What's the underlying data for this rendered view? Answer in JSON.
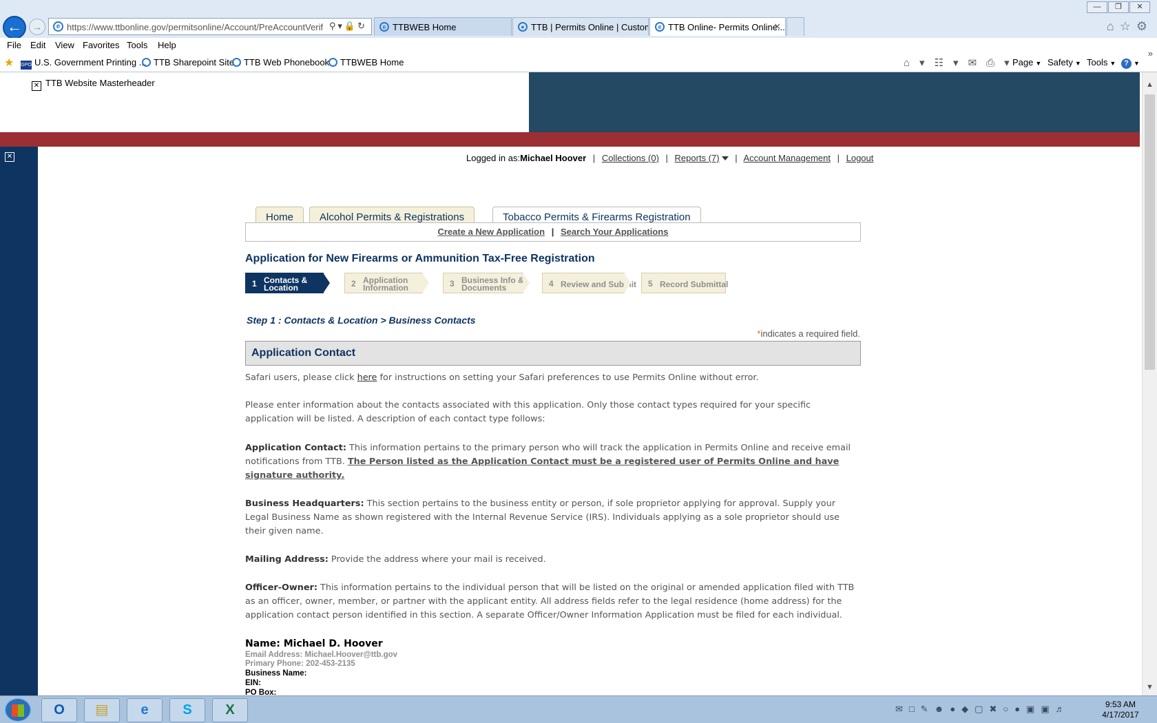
{
  "browser": {
    "address_url": "https://www.ttbonline.gov/permitsonline/Account/PreAccountVerific",
    "tabs": [
      {
        "title": "TTBWEB Home"
      },
      {
        "title": "TTB | Permits Online | Custom..."
      },
      {
        "title": "TTB Online- Permits Online..."
      }
    ],
    "menu": [
      "File",
      "Edit",
      "View",
      "Favorites",
      "Tools",
      "Help"
    ],
    "favorites": [
      {
        "label": "U.S. Government Printing ..."
      },
      {
        "label": "TTB Sharepoint Site"
      },
      {
        "label": "TTB Web Phonebook"
      },
      {
        "label": "TTBWEB Home"
      }
    ],
    "commands": [
      "Page",
      "Safety",
      "Tools"
    ],
    "gpo_badge": "GPO"
  },
  "masthead": {
    "broken_image_label": "TTB Website Masterheader"
  },
  "user_bar": {
    "logged_in_prefix": "Logged in as:",
    "user_name": "Michael Hoover",
    "collections": "Collections (0)",
    "reports": "Reports (7)",
    "account_management": "Account Management",
    "logout": "Logout"
  },
  "main_tabs": [
    {
      "label": "Home"
    },
    {
      "label": "Alcohol Permits & Registrations"
    },
    {
      "label": "Tobacco Permits & Firearms Registration"
    }
  ],
  "subnav": {
    "create": "Create a New Application",
    "search": "Search Your Applications"
  },
  "page_title": "Application for New Firearms or Ammunition Tax-Free Registration",
  "steps": [
    {
      "num": "1",
      "line1": "Contacts &",
      "line2": "Location"
    },
    {
      "num": "2",
      "line1": "Application",
      "line2": "Information"
    },
    {
      "num": "3",
      "line1": "Business Info &",
      "line2": "Documents"
    },
    {
      "num": "4",
      "line1": "Review and Submit",
      "line2": ""
    },
    {
      "num": "5",
      "line1": "Record Submittal",
      "line2": ""
    }
  ],
  "step_heading": "Step 1 : Contacts & Location > Business Contacts",
  "required_note": {
    "star": "*",
    "text": "indicates a required field."
  },
  "section_title": "Application Contact",
  "content": {
    "safari_pre": "Safari users, please click ",
    "safari_link": "here",
    "safari_post": " for instructions on setting your Safari preferences to use Permits Online without error.",
    "intro": "Please enter information about the contacts associated with this application.  Only those contact types required for your specific application will be listed.  A description of each contact type follows:",
    "app_contact_label": "Application Contact:",
    "app_contact_text": " This information pertains to the primary person who will track the application in Permits Online and receive email notifications from TTB. ",
    "app_contact_emph": "The Person listed as the Application Contact must be a registered user of Permits Online and have signature authority.",
    "hq_label": "Business Headquarters:",
    "hq_text": " This section pertains to the business entity or person, if sole proprietor applying for approval.  Supply your Legal Business Name as shown registered with the Internal Revenue Service (IRS). Individuals applying as a sole proprietor should use their given name.",
    "mail_label": "Mailing Address:",
    "mail_text": " Provide the address where your mail is received.",
    "officer_label": "Officer-Owner:",
    "officer_text": " This information pertains to the individual person that will be listed on the original or amended application filed with TTB as an officer, owner, member, or partner with the applicant entity.  All address fields refer to the legal residence (home address) for the application contact person identified in this section.  A separate Officer/Owner Information Application must be filed for each individual."
  },
  "contact": {
    "name": "Name: Michael D. Hoover",
    "email": "Email Address: Michael.Hoover@ttb.gov",
    "phone": "Primary Phone: 202-453-2135",
    "business_name": "Business Name:",
    "ein": "EIN:",
    "po_box": "PO Box:"
  },
  "clock": {
    "time": "9:53 AM",
    "date": "4/17/2017"
  }
}
